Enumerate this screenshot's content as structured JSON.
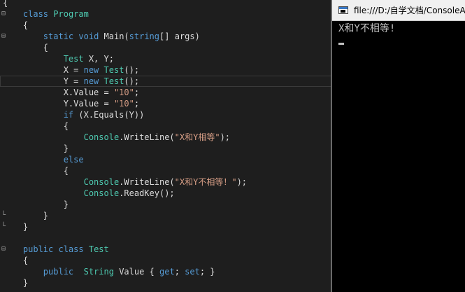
{
  "editor": {
    "lines": [
      [
        {
          "t": "{",
          "c": "pl"
        }
      ],
      [
        {
          "t": "    ",
          "c": "pl"
        },
        {
          "t": "class",
          "c": "kw"
        },
        {
          "t": " ",
          "c": "pl"
        },
        {
          "t": "Program",
          "c": "ty"
        }
      ],
      [
        {
          "t": "    {",
          "c": "pl"
        }
      ],
      [
        {
          "t": "        ",
          "c": "pl"
        },
        {
          "t": "static",
          "c": "kw"
        },
        {
          "t": " ",
          "c": "pl"
        },
        {
          "t": "void",
          "c": "kw"
        },
        {
          "t": " Main(",
          "c": "pl"
        },
        {
          "t": "string",
          "c": "kw"
        },
        {
          "t": "[] args)",
          "c": "pl"
        }
      ],
      [
        {
          "t": "        {",
          "c": "pl"
        }
      ],
      [
        {
          "t": "            ",
          "c": "pl"
        },
        {
          "t": "Test",
          "c": "ty"
        },
        {
          "t": " X, Y;",
          "c": "pl"
        }
      ],
      [
        {
          "t": "            X = ",
          "c": "pl"
        },
        {
          "t": "new",
          "c": "kw"
        },
        {
          "t": " ",
          "c": "pl"
        },
        {
          "t": "Test",
          "c": "ty"
        },
        {
          "t": "();",
          "c": "pl"
        }
      ],
      [
        {
          "t": "            Y = ",
          "c": "pl"
        },
        {
          "t": "new",
          "c": "kw"
        },
        {
          "t": " ",
          "c": "pl"
        },
        {
          "t": "Test",
          "c": "ty"
        },
        {
          "t": "();",
          "c": "pl"
        }
      ],
      [
        {
          "t": "            X.Value = ",
          "c": "pl"
        },
        {
          "t": "\"10\"",
          "c": "str"
        },
        {
          "t": ";",
          "c": "pl"
        }
      ],
      [
        {
          "t": "            Y.Value = ",
          "c": "pl"
        },
        {
          "t": "\"10\"",
          "c": "str"
        },
        {
          "t": ";",
          "c": "pl"
        }
      ],
      [
        {
          "t": "            ",
          "c": "pl"
        },
        {
          "t": "if",
          "c": "kw"
        },
        {
          "t": " (X.Equals(Y))",
          "c": "pl"
        }
      ],
      [
        {
          "t": "            {",
          "c": "pl"
        }
      ],
      [
        {
          "t": "                ",
          "c": "pl"
        },
        {
          "t": "Console",
          "c": "ty"
        },
        {
          "t": ".WriteLine(",
          "c": "pl"
        },
        {
          "t": "\"X和Y相等\"",
          "c": "str"
        },
        {
          "t": ");",
          "c": "pl"
        }
      ],
      [
        {
          "t": "            }",
          "c": "pl"
        }
      ],
      [
        {
          "t": "            ",
          "c": "pl"
        },
        {
          "t": "else",
          "c": "kw"
        }
      ],
      [
        {
          "t": "            {",
          "c": "pl"
        }
      ],
      [
        {
          "t": "                ",
          "c": "pl"
        },
        {
          "t": "Console",
          "c": "ty"
        },
        {
          "t": ".WriteLine(",
          "c": "pl"
        },
        {
          "t": "\"X和Y不相等！\"",
          "c": "str"
        },
        {
          "t": ");",
          "c": "pl"
        }
      ],
      [
        {
          "t": "                ",
          "c": "pl"
        },
        {
          "t": "Console",
          "c": "ty"
        },
        {
          "t": ".ReadKey();",
          "c": "pl"
        }
      ],
      [
        {
          "t": "            }",
          "c": "pl"
        }
      ],
      [
        {
          "t": "        }",
          "c": "pl"
        }
      ],
      [
        {
          "t": "    }",
          "c": "pl"
        }
      ],
      [
        {
          "t": "",
          "c": "pl"
        }
      ],
      [
        {
          "t": "    ",
          "c": "pl"
        },
        {
          "t": "public",
          "c": "kw"
        },
        {
          "t": " ",
          "c": "pl"
        },
        {
          "t": "class",
          "c": "kw"
        },
        {
          "t": " ",
          "c": "pl"
        },
        {
          "t": "Test",
          "c": "ty"
        }
      ],
      [
        {
          "t": "    {",
          "c": "pl"
        }
      ],
      [
        {
          "t": "        ",
          "c": "pl"
        },
        {
          "t": "public",
          "c": "kw"
        },
        {
          "t": "  ",
          "c": "pl"
        },
        {
          "t": "String",
          "c": "ty"
        },
        {
          "t": " Value { ",
          "c": "pl"
        },
        {
          "t": "get",
          "c": "kw"
        },
        {
          "t": "; ",
          "c": "pl"
        },
        {
          "t": "set",
          "c": "kw"
        },
        {
          "t": "; }",
          "c": "pl"
        }
      ],
      [
        {
          "t": "    }",
          "c": "pl"
        }
      ]
    ]
  },
  "console": {
    "title": "file:///D:/自学文档/ConsoleA",
    "output": "X和Y不相等!"
  },
  "colors": {
    "keyword": "#569cd6",
    "type": "#4ec9b0",
    "string": "#d69d85",
    "plain": "#dcdcdc",
    "editor_bg": "#1e1e1e",
    "console_bg": "#000000"
  }
}
